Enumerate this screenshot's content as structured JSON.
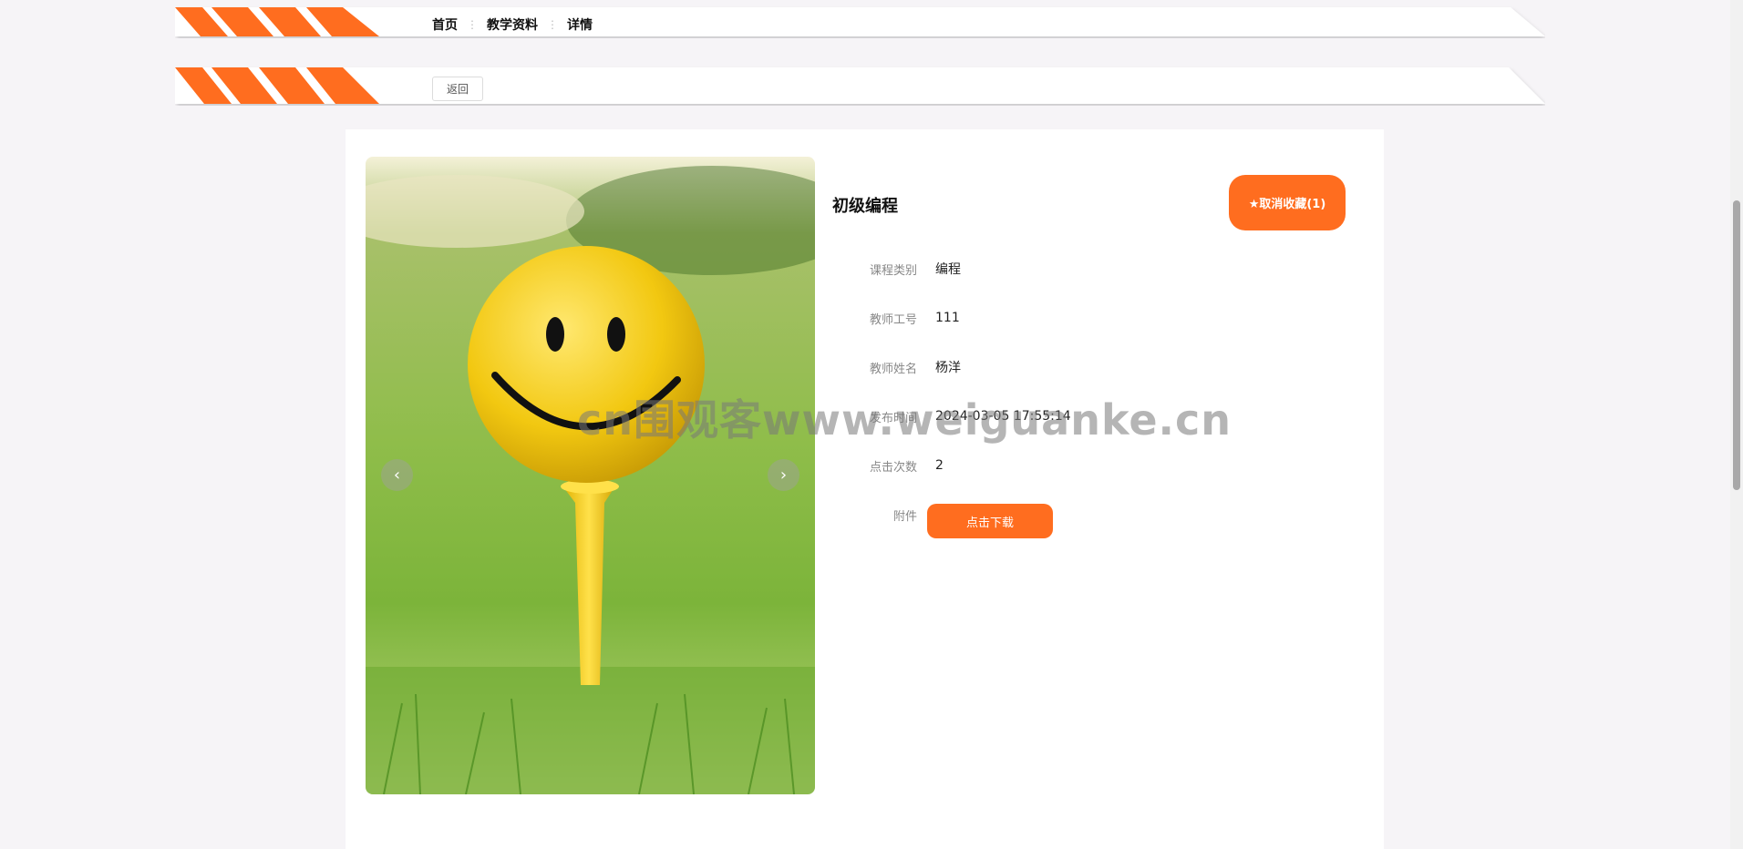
{
  "breadcrumb": {
    "items": [
      "首页",
      "教学资料",
      "详情"
    ],
    "separator": "⋮"
  },
  "back_label": "返回",
  "course": {
    "title": "初级编程",
    "favorite_label": "★取消收藏(1)",
    "fields": [
      {
        "label": "课程类别",
        "value": "编程"
      },
      {
        "label": "教师工号",
        "value": "111"
      },
      {
        "label": "教师姓名",
        "value": "杨洋"
      },
      {
        "label": "发布时间",
        "value": "2024-03-05 17:55:14"
      },
      {
        "label": "点击次数",
        "value": "2"
      }
    ],
    "attachment_label": "附件",
    "download_label": "点击下载"
  },
  "carousel": {
    "prev_icon": "‹",
    "next_icon": "›"
  },
  "watermark": "cn围观客www.weiguanke.cn",
  "colors": {
    "accent": "#ff6d1f",
    "background": "#f6f4f7"
  }
}
